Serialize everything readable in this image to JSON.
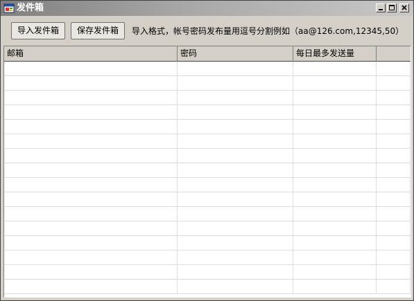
{
  "window": {
    "title": "发件箱"
  },
  "toolbar": {
    "import_label": "导入发件箱",
    "save_label": "保存发件箱",
    "hint": "导入格式，帐号密码发布量用逗号分割例如（aa@126.com,12345,50）"
  },
  "grid": {
    "columns": [
      "邮箱",
      "密码",
      "每日最多发送量"
    ],
    "rows": [
      [
        "",
        "",
        ""
      ],
      [
        "",
        "",
        ""
      ],
      [
        "",
        "",
        ""
      ],
      [
        "",
        "",
        ""
      ],
      [
        "",
        "",
        ""
      ],
      [
        "",
        "",
        ""
      ],
      [
        "",
        "",
        ""
      ],
      [
        "",
        "",
        ""
      ],
      [
        "",
        "",
        ""
      ],
      [
        "",
        "",
        ""
      ],
      [
        "",
        "",
        ""
      ],
      [
        "",
        "",
        ""
      ],
      [
        "",
        "",
        ""
      ],
      [
        "",
        "",
        ""
      ],
      [
        "",
        "",
        ""
      ],
      [
        "",
        "",
        ""
      ]
    ]
  },
  "colors": {
    "titlebar_gradient_start": "#808080",
    "titlebar_gradient_end": "#c8c8c8",
    "window_background": "#d4d0c8",
    "grid_background": "#ffffff",
    "gridline": "#dcdcdc"
  },
  "icons": [
    "app-window-icon",
    "minimize-icon",
    "maximize-icon",
    "close-icon"
  ]
}
